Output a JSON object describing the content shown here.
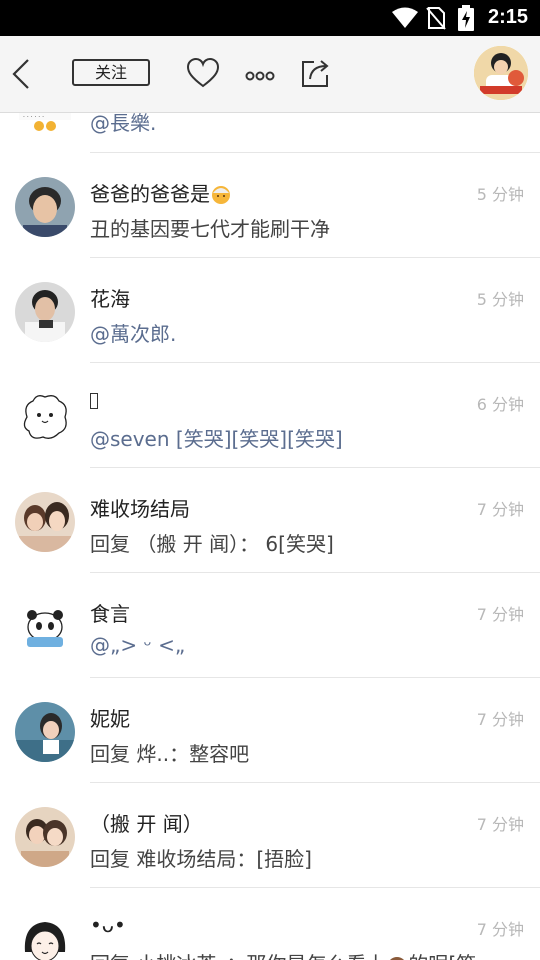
{
  "status_bar": {
    "time": "2:15",
    "icons": [
      "wifi-icon",
      "no-sim-icon",
      "battery-charging-icon"
    ]
  },
  "toolbar": {
    "back_icon": "chevron-left-icon",
    "follow_label": "关注",
    "like_icon": "heart-outline-icon",
    "more_icon": "more-dots-icon",
    "share_icon": "share-icon",
    "avatar_icon": "user-avatar"
  },
  "comments": {
    "partial_text": "@長樂.",
    "items": [
      {
        "name": "爸爸的爸爸是",
        "time": "5 分钟",
        "text": "丑的基因要七代才能刷干净",
        "mention": false
      },
      {
        "name": "花海",
        "time": "5 分钟",
        "text": "@萬次郎.",
        "mention": true
      },
      {
        "name": "",
        "time": "6 分钟",
        "text": "@seven [笑哭][笑哭][笑哭]",
        "mention": true
      },
      {
        "name": "难收场结局",
        "time": "7 分钟",
        "text": "回复 （搬 开 闻）： 6[笑哭]",
        "mention": false
      },
      {
        "name": "食言",
        "time": "7 分钟",
        "text": "@„> ᵕ <„",
        "mention": true
      },
      {
        "name": "妮妮",
        "time": "7 分钟",
        "text": "回复 烨..：整容吧",
        "mention": false
      },
      {
        "name": "（搬 开 闻）",
        "time": "7 分钟",
        "text": "回复 难收场结局：[捂脸]",
        "mention": false
      },
      {
        "name": "•ᴗ•",
        "time": "7 分钟",
        "text": "回复 小桃冰茶_：那你是怎么看上",
        "text_tail": "的呢[笑",
        "mention": false
      }
    ]
  },
  "colors": {
    "status_bar_bg": "#000000",
    "toolbar_bg": "#f5f5f5",
    "mention": "#5b6d8f",
    "time": "#b8b8b8"
  }
}
